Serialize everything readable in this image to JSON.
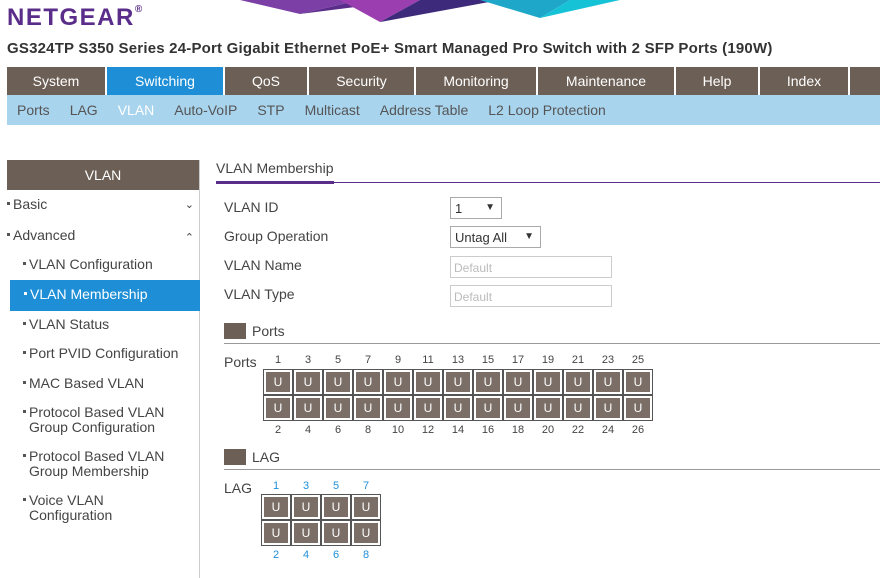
{
  "brand": {
    "logo_text": "NETGEAR",
    "logo_mark": "®"
  },
  "product_title": "GS324TP S350 Series 24-Port Gigabit Ethernet PoE+ Smart Managed Pro Switch with 2 SFP Ports (190W)",
  "main_nav": [
    {
      "label": "System"
    },
    {
      "label": "Switching",
      "active": true
    },
    {
      "label": "QoS"
    },
    {
      "label": "Security"
    },
    {
      "label": "Monitoring"
    },
    {
      "label": "Maintenance"
    },
    {
      "label": "Help"
    },
    {
      "label": "Index"
    }
  ],
  "sub_nav": [
    {
      "label": "Ports"
    },
    {
      "label": "LAG"
    },
    {
      "label": "VLAN",
      "active": true
    },
    {
      "label": "Auto-VoIP"
    },
    {
      "label": "STP"
    },
    {
      "label": "Multicast"
    },
    {
      "label": "Address Table"
    },
    {
      "label": "L2 Loop Protection"
    }
  ],
  "sidebar": {
    "header": "VLAN",
    "groups": [
      {
        "label": "Basic",
        "chevron": "chevron-down-icon"
      },
      {
        "label": "Advanced",
        "chevron": "chevron-up-icon"
      }
    ],
    "items": [
      {
        "label": "VLAN Configuration"
      },
      {
        "label": "VLAN Membership",
        "active": true
      },
      {
        "label": "VLAN Status"
      },
      {
        "label": "Port PVID Configuration"
      },
      {
        "label": "MAC Based VLAN"
      },
      {
        "label": "Protocol Based VLAN",
        "label2": "Group Configuration"
      },
      {
        "label": "Protocol Based VLAN",
        "label2": "Group Membership"
      },
      {
        "label": "Voice VLAN",
        "label2": "Configuration"
      }
    ]
  },
  "content": {
    "section_tab": "VLAN Membership",
    "form": {
      "vlan_id_label": "VLAN ID",
      "vlan_id_value": "1",
      "group_op_label": "Group Operation",
      "group_op_value": "Untag All",
      "vlan_name_label": "VLAN Name",
      "vlan_name_placeholder": "Default",
      "vlan_type_label": "VLAN Type",
      "vlan_type_placeholder": "Default"
    },
    "ports_section": {
      "title": "Ports",
      "row_label": "Ports",
      "top_numbers": [
        "1",
        "3",
        "5",
        "7",
        "9",
        "11",
        "13",
        "15",
        "17",
        "19",
        "21",
        "23",
        "25"
      ],
      "bottom_numbers": [
        "2",
        "4",
        "6",
        "8",
        "10",
        "12",
        "14",
        "16",
        "18",
        "20",
        "22",
        "24",
        "26"
      ],
      "port_state": "U"
    },
    "lag_section": {
      "title": "LAG",
      "row_label": "LAG",
      "top_numbers": [
        "1",
        "3",
        "5",
        "7"
      ],
      "bottom_numbers": [
        "2",
        "4",
        "6",
        "8"
      ],
      "port_state": "U"
    }
  },
  "colors": {
    "brand_purple": "#5a2d8a",
    "nav_brown": "#6c5f56",
    "accent_blue": "#1e8fd6",
    "subnav_blue": "#a9d4ee"
  }
}
